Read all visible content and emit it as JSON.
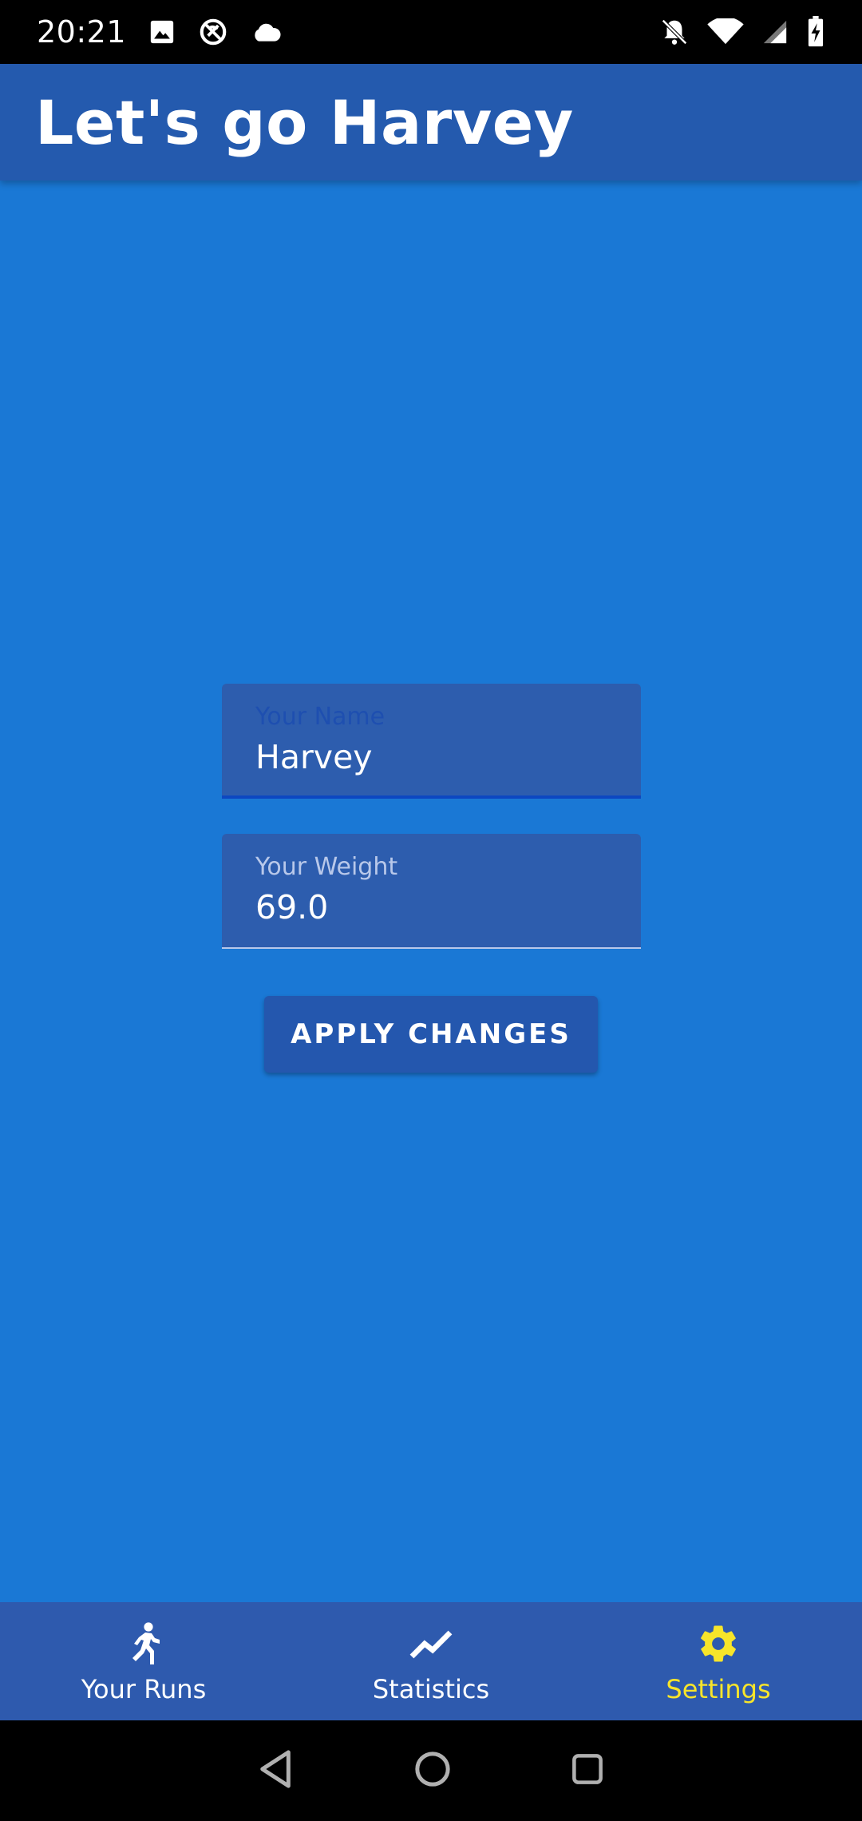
{
  "status_bar": {
    "time": "20:21",
    "left_icons": [
      "image-icon",
      "sync-disabled-icon",
      "cloud-icon"
    ],
    "right_icons": [
      "notifications-off-icon",
      "wifi-icon",
      "signal-icon",
      "battery-charging-icon"
    ]
  },
  "app_bar": {
    "title": "Let's go Harvey"
  },
  "form": {
    "name_label": "Your Name",
    "name_value": "Harvey",
    "weight_label": "Your Weight",
    "weight_value": "69.0",
    "apply_label": "APPLY CHANGES"
  },
  "bottom_nav": {
    "items": [
      {
        "label": "Your Runs",
        "icon": "running-icon",
        "active": false
      },
      {
        "label": "Statistics",
        "icon": "trending-line-icon",
        "active": false
      },
      {
        "label": "Settings",
        "icon": "gear-icon",
        "active": true
      }
    ]
  },
  "colors": {
    "background": "#1a78d5",
    "app_bar": "#245aae",
    "nav_bar": "#2e5aae",
    "active_nav": "#f7e52a"
  },
  "system_nav": {
    "icons": [
      "back-icon",
      "home-icon",
      "recents-icon"
    ]
  }
}
